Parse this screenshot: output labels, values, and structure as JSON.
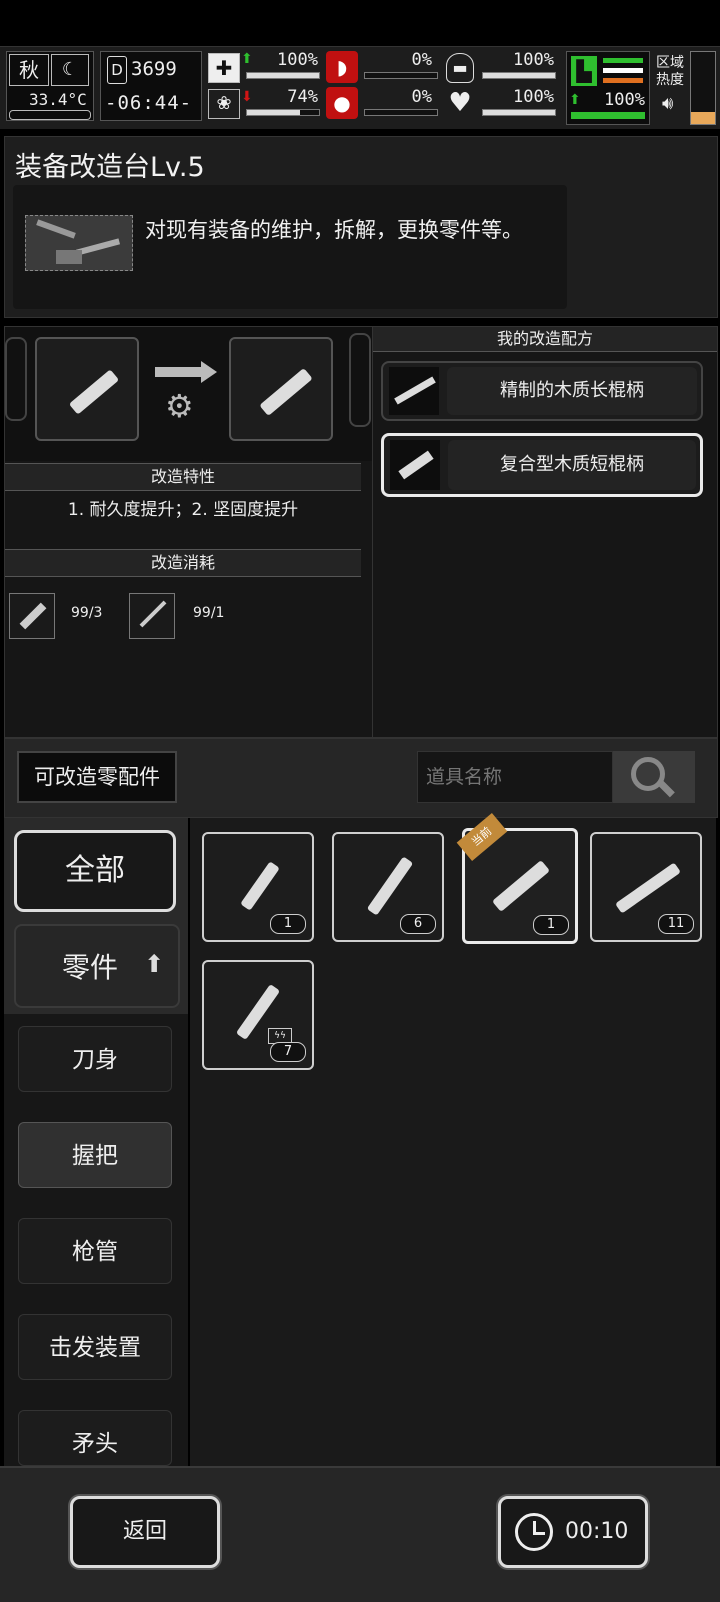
{
  "hud": {
    "season": "秋",
    "temperature": "33.4°C",
    "days": "3699",
    "time": "-06:44-",
    "health_pct": "100%",
    "stomach_pct": "0%",
    "armor_pct": "100%",
    "mood_pct": "74%",
    "blood_pct": "0%",
    "heart_pct": "100%",
    "stamina_pct": "100%",
    "zone_label_1": "区域",
    "zone_label_2": "热度",
    "bars": {
      "health": 1.0,
      "stomach": 0.0,
      "armor": 1.0,
      "mood": 0.74,
      "blood": 0.0,
      "heart": 1.0,
      "stamina": 1.0
    },
    "colors": {
      "accent_green": "#2fbf2f",
      "danger_red": "#d01515",
      "zone_orange": "#e8a85a"
    }
  },
  "station": {
    "title": "装备改造台Lv.5",
    "description": "对现有装备的维护，拆解，更换零件等。",
    "icon": "workbench-tools-icon"
  },
  "modify": {
    "traits_header": "改造特性",
    "traits_text": "1. 耐久度提升；2. 坚固度提升",
    "cost_header": "改造消耗",
    "costs": [
      {
        "icon": "wood-planks-icon",
        "amount": "99/3"
      },
      {
        "icon": "glue-tool-icon",
        "amount": "99/1"
      }
    ]
  },
  "recipes": {
    "header": "我的改造配方",
    "items": [
      {
        "label": "精制的木质长棍柄",
        "icon": "long-wood-handle-icon"
      },
      {
        "label": "复合型木质短棍柄",
        "icon": "short-wood-handle-icon"
      }
    ]
  },
  "parts": {
    "tab_label": "可改造零配件",
    "search_placeholder": "道具名称",
    "current_badge": "当前",
    "categories": [
      "全部",
      "零件",
      "刀身",
      "握把",
      "枪管",
      "击发装置",
      "矛头"
    ],
    "items": [
      {
        "count": "1",
        "icon": "wood-handle-icon"
      },
      {
        "count": "6",
        "icon": "wrapped-handle-icon"
      },
      {
        "count": "1",
        "icon": "carved-handle-icon"
      },
      {
        "count": "11",
        "icon": "bound-handle-icon"
      },
      {
        "count": "7",
        "icon": "charged-handle-icon"
      }
    ]
  },
  "footer": {
    "back_label": "返回",
    "timer_label": "00:10"
  }
}
